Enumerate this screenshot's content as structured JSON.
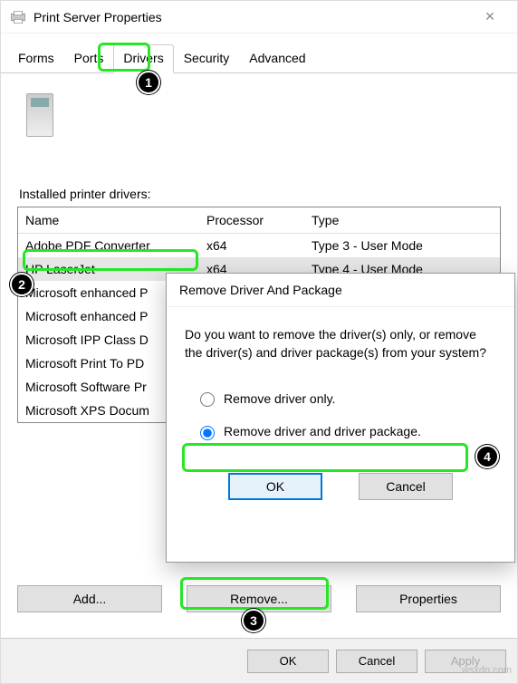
{
  "window": {
    "title": "Print Server Properties",
    "section_label": "Installed printer drivers:"
  },
  "tabs": [
    "Forms",
    "Ports",
    "Drivers",
    "Security",
    "Advanced"
  ],
  "active_tab_index": 2,
  "table": {
    "headers": {
      "name": "Name",
      "processor": "Processor",
      "type": "Type"
    },
    "rows": [
      {
        "name": "Adobe PDF Converter",
        "proc": "x64",
        "type": "Type 3 - User Mode",
        "sel": false
      },
      {
        "name": "HP LaserJet",
        "proc": "x64",
        "type": "Type 4 - User Mode",
        "sel": true
      },
      {
        "name": "Microsoft enhanced P",
        "proc": "",
        "type": "",
        "sel": false
      },
      {
        "name": "Microsoft enhanced P",
        "proc": "",
        "type": "",
        "sel": false
      },
      {
        "name": "Microsoft IPP Class D",
        "proc": "",
        "type": "",
        "sel": false
      },
      {
        "name": "Microsoft Print To PD",
        "proc": "",
        "type": "",
        "sel": false
      },
      {
        "name": "Microsoft Software Pr",
        "proc": "",
        "type": "",
        "sel": false
      },
      {
        "name": "Microsoft XPS Docum",
        "proc": "",
        "type": "",
        "sel": false
      }
    ]
  },
  "buttons": {
    "add": "Add...",
    "remove": "Remove...",
    "properties": "Properties"
  },
  "footer": {
    "ok": "OK",
    "cancel": "Cancel",
    "apply": "Apply"
  },
  "dialog": {
    "title": "Remove Driver And Package",
    "message": "Do you want to remove the driver(s) only, or remove the driver(s) and driver package(s) from your system?",
    "option1": "Remove driver only.",
    "option2": "Remove driver and driver package.",
    "ok": "OK",
    "cancel": "Cancel",
    "selected": 2
  },
  "callouts": {
    "1": "1",
    "2": "2",
    "3": "3",
    "4": "4"
  },
  "watermark": "wsxdn.com"
}
